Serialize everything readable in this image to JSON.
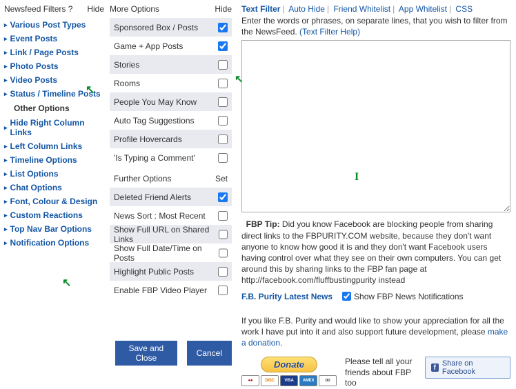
{
  "col1": {
    "header": "Newsfeed Filters",
    "help": "?",
    "hide": "Hide",
    "items": [
      "Various Post Types",
      "Event Posts",
      "Link / Page Posts",
      "Photo Posts",
      "Video Posts",
      "Status / Timeline Posts"
    ],
    "other_label": "Other Options",
    "items2": [
      "Hide Right Column Links",
      "Left Column Links",
      "Timeline Options",
      "List Options",
      "Chat Options",
      "Font, Colour & Design",
      "Custom Reactions",
      "Top Nav Bar Options",
      "Notification Options"
    ]
  },
  "col2": {
    "header": "More Options",
    "hide": "Hide",
    "opts": [
      {
        "label": "Sponsored Box / Posts",
        "checked": true
      },
      {
        "label": "Game + App Posts",
        "checked": true
      },
      {
        "label": "Stories",
        "checked": false
      },
      {
        "label": "Rooms",
        "checked": false
      },
      {
        "label": "People You May Know",
        "checked": false
      },
      {
        "label": "Auto Tag Suggestions",
        "checked": false
      },
      {
        "label": "Profile Hovercards",
        "checked": false
      },
      {
        "label": "'Is Typing a Comment'",
        "checked": false
      }
    ],
    "further_header": "Further Options",
    "set": "Set",
    "further": [
      {
        "label": "Deleted Friend Alerts",
        "checked": true
      },
      {
        "label": "News Sort : Most Recent",
        "checked": false
      },
      {
        "label": "Show Full URL on Shared Links",
        "checked": false
      },
      {
        "label": "Show Full Date/Time on Posts",
        "checked": false
      },
      {
        "label": "Highlight Public Posts",
        "checked": false
      },
      {
        "label": "Enable FBP Video Player",
        "checked": false
      }
    ],
    "save": "Save and Close",
    "cancel": "Cancel"
  },
  "col3": {
    "tabs": [
      "Text Filter",
      "Auto Hide",
      "Friend Whitelist",
      "App Whitelist",
      "CSS"
    ],
    "intro": "Enter the words or phrases, on separate lines, that you wish to filter from the NewsFeed. ",
    "help_link": "(Text Filter Help)",
    "tip_label": "FBP Tip:",
    "tip_text": " Did you know Facebook are blocking people from sharing direct links to the FBPURITY.COM website, because they don't want anyone to know how good it is and they don't want Facebook users having control over what they see on their own computers. You can get around this by sharing links to the FBP fan page at http://facebook.com/fluffbustingpurity instead",
    "news_link": "F.B. Purity Latest News",
    "news_cb": "Show FBP News Notifications",
    "appreciate": "If you like F.B. Purity and would like to show your appreciation for all the work I have put into it and also support future development, please ",
    "donate_link": "make a donation",
    "donate_btn": "Donate",
    "tell": "Please tell all your friends about FBP too",
    "share": "Share on Facebook"
  }
}
